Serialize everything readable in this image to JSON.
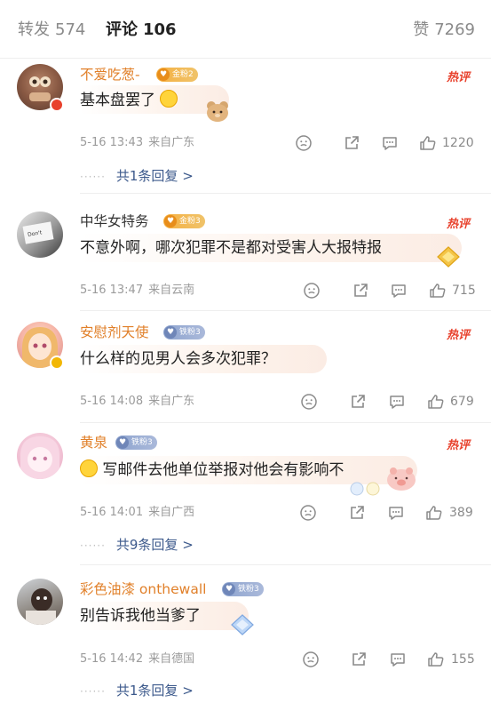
{
  "tabs": {
    "repost_label": "转发",
    "repost_count": "574",
    "comments_label": "评论",
    "comments_count": "106",
    "likes_label": "赞",
    "likes_count": "7269"
  },
  "hot_label": "热评",
  "colors": {
    "username": "#e1802a",
    "hot": "#e8412c",
    "reply_link": "#3d5a8c",
    "meta": "#9b9b9b"
  },
  "comments": [
    {
      "username": "不爱吃葱-",
      "badge": "金粉2",
      "text": "基本盘罢了",
      "emoji": "laugh-cry-emoji",
      "time": "5-16 13:43",
      "location": "来自广东",
      "likes": "1220",
      "replies": "共1条回复 >"
    },
    {
      "username": "中华女特务",
      "badge": "金粉3",
      "text": "不意外啊，哪次犯罪不是都对受害人大报特报",
      "time": "5-16 13:47",
      "location": "来自云南",
      "likes": "715"
    },
    {
      "username": "安慰剂天使",
      "badge": "铁粉3",
      "text": "什么样的见男人会多次犯罪？",
      "time": "5-16 14:08",
      "location": "来自广东",
      "likes": "679"
    },
    {
      "username": "黄泉",
      "badge": "铁粉3",
      "text": "写邮件去他单位举报对他会有影响不",
      "emoji": "thinking-emoji",
      "time": "5-16 14:01",
      "location": "来自广西",
      "likes": "389",
      "replies": "共9条回复 >"
    },
    {
      "username": "彩色油漆 onthewall",
      "badge": "铁粉3",
      "text": "别告诉我他当爹了",
      "time": "5-16 14:42",
      "location": "来自德国",
      "likes": "155",
      "replies": "共1条回复 >"
    }
  ],
  "icons": {
    "react": "emoji-react-icon",
    "share": "share-icon",
    "reply": "comment-icon",
    "like": "thumbs-up-icon"
  }
}
